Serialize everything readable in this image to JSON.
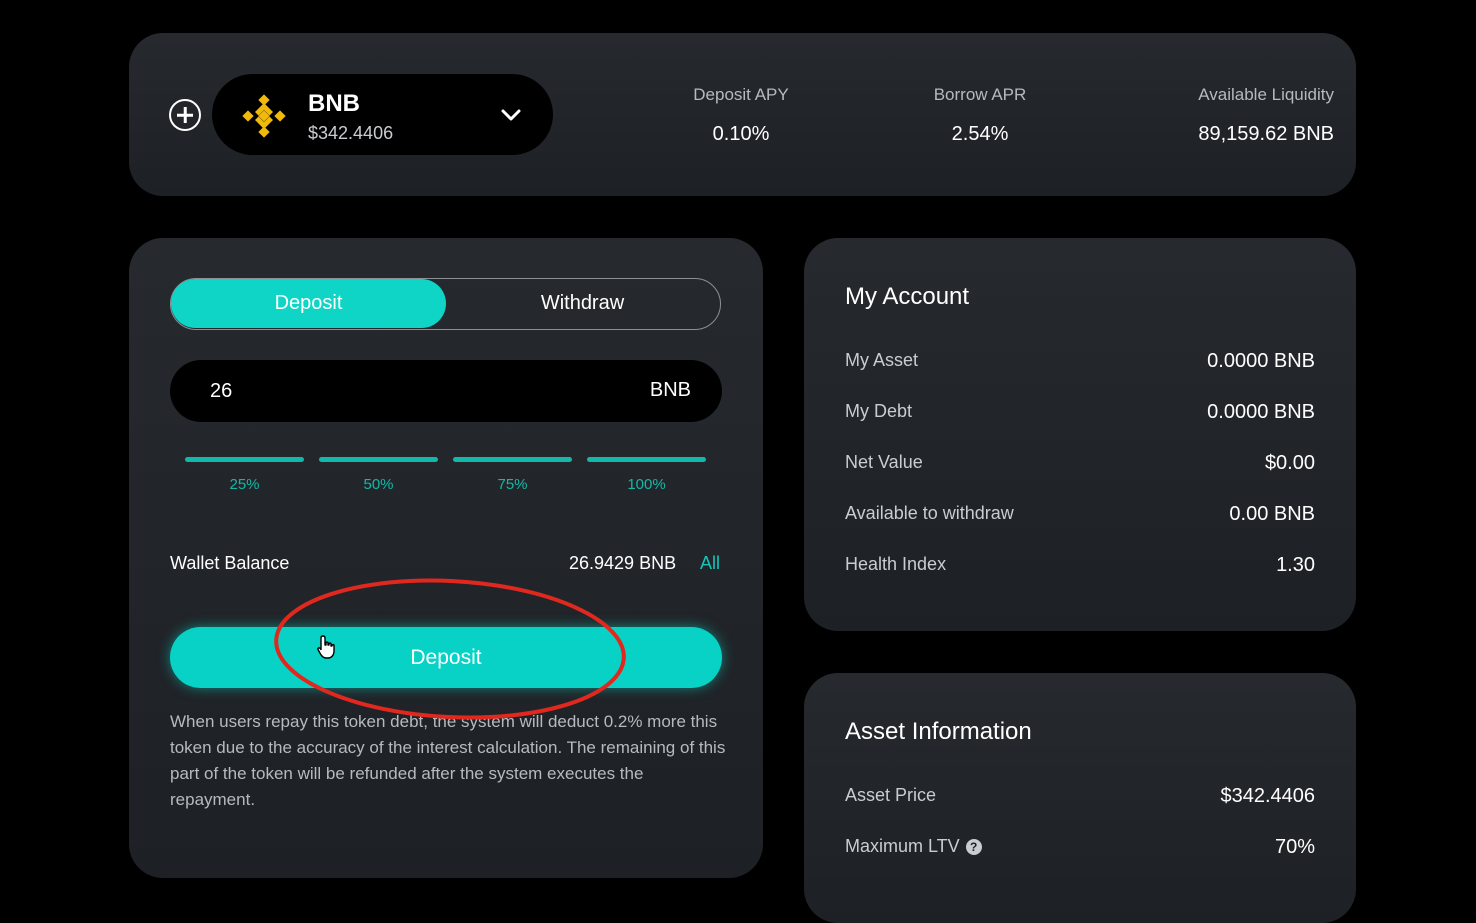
{
  "header": {
    "token": {
      "symbol": "BNB",
      "price": "$342.4406"
    },
    "stats": [
      {
        "label": "Deposit APY",
        "value": "0.10%"
      },
      {
        "label": "Borrow APR",
        "value": "2.54%"
      },
      {
        "label": "Available Liquidity",
        "value": "89,159.62 BNB"
      }
    ]
  },
  "form": {
    "tabs": {
      "deposit": "Deposit",
      "withdraw": "Withdraw"
    },
    "amount": {
      "value": "26",
      "unit": "BNB"
    },
    "percentages": [
      "25%",
      "50%",
      "75%",
      "100%"
    ],
    "wallet": {
      "label": "Wallet Balance",
      "value": "26.9429 BNB",
      "all_label": "All"
    },
    "submit_label": "Deposit",
    "notice": "When users repay this token debt, the system will deduct 0.2% more this token due to the accuracy of the interest calculation. The remaining of this part of the token will be refunded after the system executes the repayment."
  },
  "account": {
    "title": "My Account",
    "rows": [
      {
        "label": "My Asset",
        "value": "0.0000 BNB"
      },
      {
        "label": "My Debt",
        "value": "0.0000 BNB"
      },
      {
        "label": "Net Value",
        "value": "$0.00"
      },
      {
        "label": "Available to withdraw",
        "value": "0.00 BNB"
      },
      {
        "label": "Health Index",
        "value": "1.30"
      }
    ]
  },
  "asset_info": {
    "title": "Asset Information",
    "rows": [
      {
        "label": "Asset Price",
        "value": "$342.4406"
      },
      {
        "label": "Maximum LTV",
        "value": "70%",
        "help": "?"
      }
    ]
  },
  "colors": {
    "accent": "#07d2c5",
    "annotation": "#e0281e",
    "brand": "#f0b90b"
  },
  "icons": [
    "plus-circle-icon",
    "bnb-logo-icon",
    "chevron-down-icon",
    "hand-pointer-icon",
    "help-icon"
  ]
}
